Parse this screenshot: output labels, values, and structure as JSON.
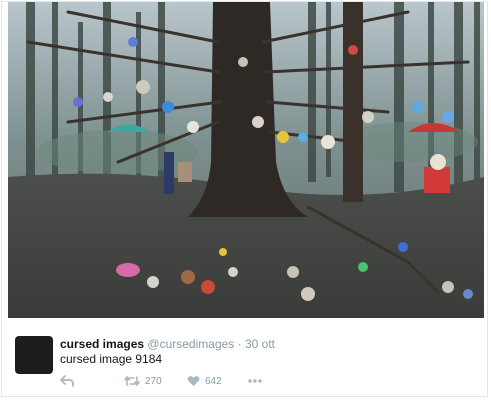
{
  "photo": {
    "description_icon": "forest-photo"
  },
  "tweet": {
    "display_name": "cursed images",
    "handle": "@cursedimages",
    "separator": "·",
    "date": "30 ott",
    "text": "cursed image 9184",
    "actions": {
      "reply_icon": "reply-icon",
      "retweet_icon": "retweet-icon",
      "retweet_count": "270",
      "like_icon": "heart-icon",
      "like_count": "642",
      "more_icon": "more-icon"
    }
  },
  "colors": {
    "text_primary": "#14171a",
    "text_secondary": "#8899a6",
    "icon": "#aab8c2",
    "border": "#e1e8ed",
    "avatar": "#1d1d1f"
  }
}
